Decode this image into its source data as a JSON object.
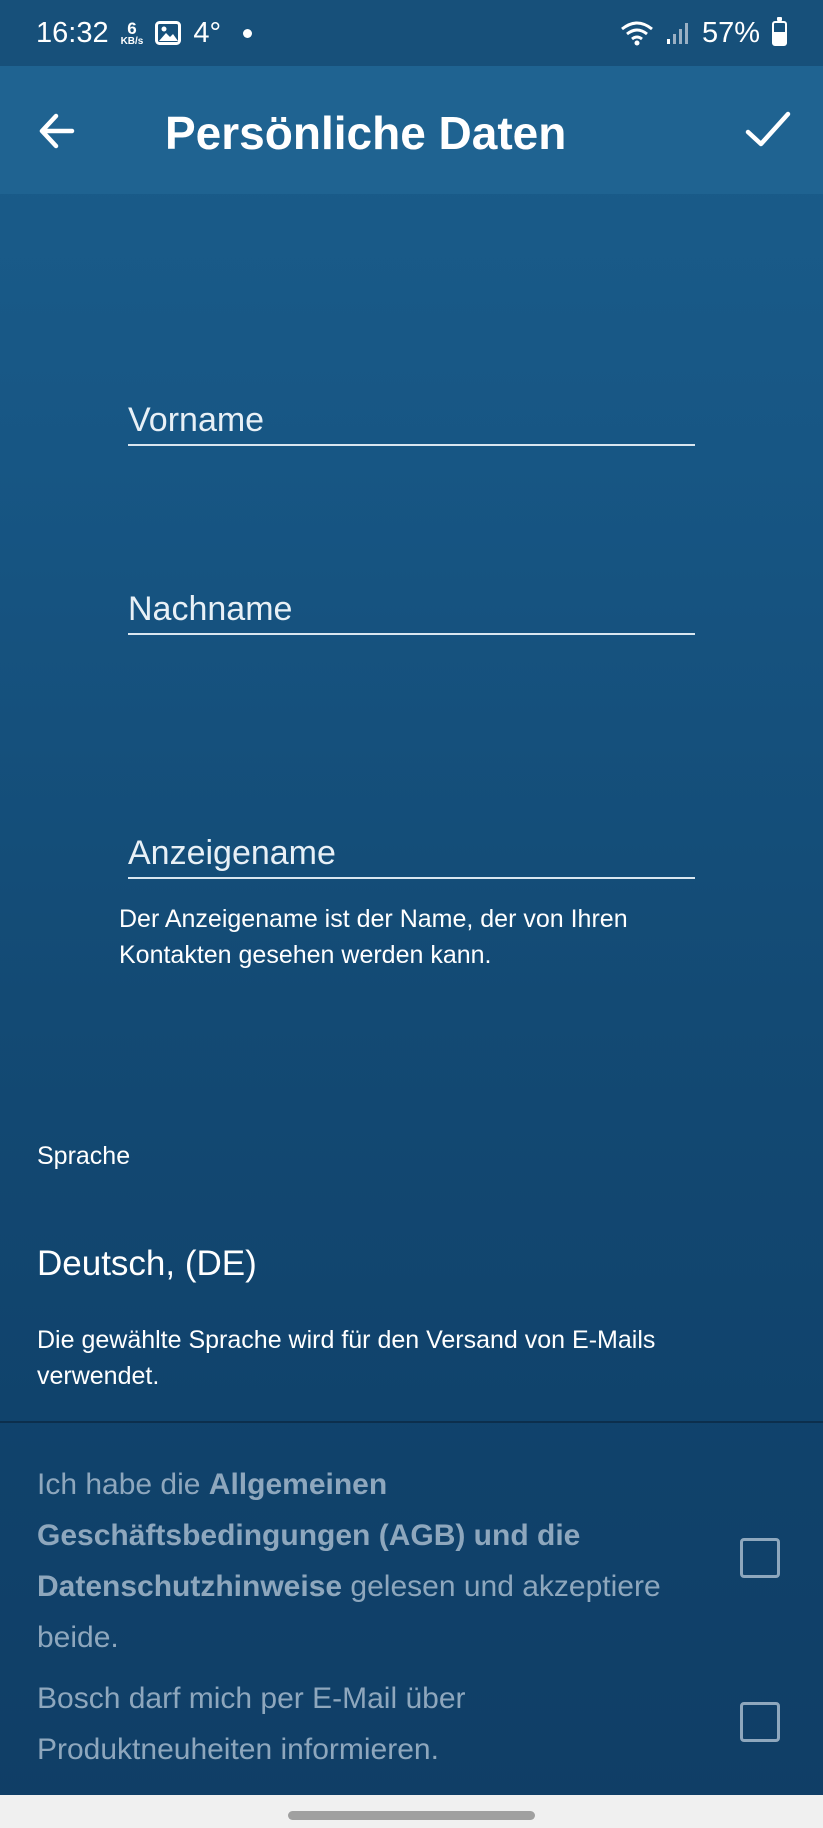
{
  "status_bar": {
    "time": "16:32",
    "net_speed": "6",
    "net_unit": "KB/s",
    "temperature": "4°",
    "battery": "57%",
    "icons": [
      "image-icon",
      "wifi-icon",
      "signal-icon",
      "battery-icon"
    ]
  },
  "app_bar": {
    "title": "Persönliche Daten",
    "back_icon": "arrow-left-icon",
    "confirm_icon": "checkmark-icon"
  },
  "form": {
    "first_name": {
      "placeholder": "Vorname",
      "value": ""
    },
    "last_name": {
      "placeholder": "Nachname",
      "value": ""
    },
    "display_name": {
      "placeholder": "Anzeigename",
      "value": "",
      "hint_line1": "Der Anzeigename ist der Name, der von Ihren",
      "hint_line2": "Kontakten gesehen werden kann."
    }
  },
  "language": {
    "label": "Sprache",
    "value": "Deutsch, (DE)",
    "hint_line1": "Die gewählte Sprache wird für den Versand von E-Mails",
    "hint_line2": "verwendet."
  },
  "consent": {
    "terms_prefix": "Ich habe die ",
    "terms_bold1": "Allgemeinen",
    "terms_bold2": "Geschäftsbedingungen (AGB) und die",
    "terms_bold3": "Datenschutzhinweise",
    "terms_mid": " gelesen und akzeptiere",
    "terms_end": "beide.",
    "terms_checked": false,
    "newsletter_line1": "Bosch darf mich per E-Mail über",
    "newsletter_line2": "Produktneuheiten informieren.",
    "newsletter_checked": false
  },
  "colors": {
    "background_top": "#1b5e8c",
    "background_bottom": "#103e66",
    "disabled_text": "#8ea7bd"
  }
}
